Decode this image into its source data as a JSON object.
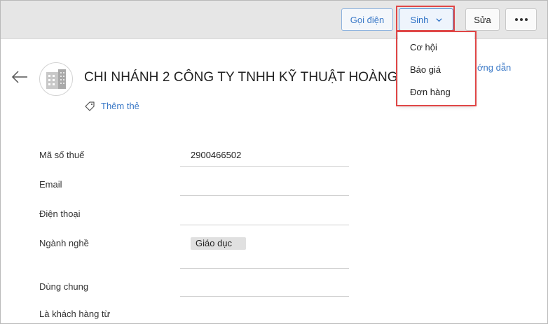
{
  "toolbar": {
    "call_label": "Gọi điện",
    "generate_label": "Sinh",
    "edit_label": "Sửa"
  },
  "generate_menu": {
    "items": [
      {
        "label": "Cơ hội"
      },
      {
        "label": "Báo giá"
      },
      {
        "label": "Đơn hàng"
      }
    ]
  },
  "header": {
    "title": "CHI NHÁNH 2 CÔNG TY TNHH KỸ THUẬT HOÀNG",
    "guide_link": "ớng dẫn",
    "add_tag_label": "Thêm thẻ"
  },
  "fields": {
    "tax_code": {
      "label": "Mã số thuế",
      "value": "2900466502"
    },
    "email": {
      "label": "Email",
      "value": ""
    },
    "phone": {
      "label": "Điện thoại",
      "value": ""
    },
    "industry": {
      "label": "Ngành nghề",
      "value": "Giáo dục"
    },
    "shared": {
      "label": "Dùng chung",
      "value": ""
    },
    "customer_since": {
      "label": "Là khách hàng từ",
      "value": ""
    }
  },
  "colors": {
    "accent": "#3b79c7",
    "highlight": "#e04646",
    "toolbar_bg": "#e6e6e6"
  }
}
